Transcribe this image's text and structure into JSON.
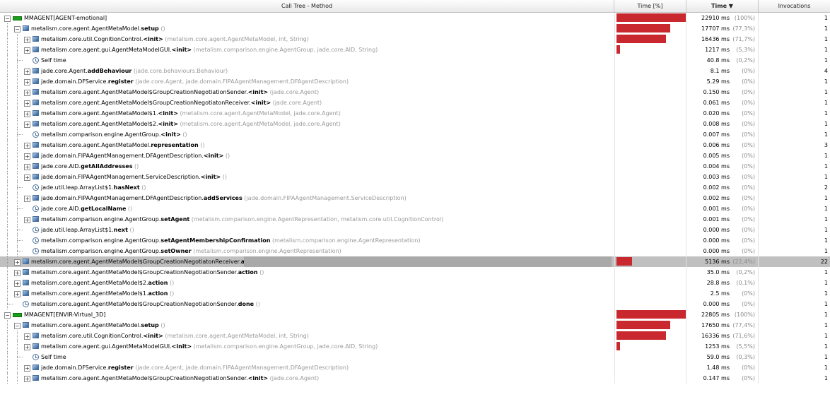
{
  "header": {
    "method": "Call Tree - Method",
    "time_pct": "Time [%]",
    "time": "Time ▼",
    "invocations": "Invocations"
  },
  "rows": [
    {
      "depth": 0,
      "exp": "-",
      "icon": "agent-icon",
      "cls": "",
      "method": "MMAGENT[AGENT-emotional]",
      "sig": "",
      "frac": 1.0,
      "time": "22910 ms",
      "pct": "(100%)",
      "inv": "1"
    },
    {
      "depth": 1,
      "exp": "-",
      "icon": "package-icon",
      "cls": "metalism.core.agent.AgentMetaModel.",
      "method": "setup",
      "sig": " ()",
      "frac": 0.773,
      "time": "17707 ms",
      "pct": "(77,3%)",
      "inv": "1"
    },
    {
      "depth": 2,
      "exp": "+",
      "icon": "package-icon",
      "cls": "metalism.core.util.CognitionControl.",
      "method": "<init>",
      "sig": " (metalism.core.agent.AgentMetaModel, int, String)",
      "frac": 0.717,
      "time": "16436 ms",
      "pct": "(71,7%)",
      "inv": "1"
    },
    {
      "depth": 2,
      "exp": "+",
      "icon": "package-icon",
      "cls": "metalism.core.agent.gui.AgentMetaModelGUI.",
      "method": "<init>",
      "sig": " (metalism.comparison.engine.AgentGroup, jade.core.AID, String)",
      "frac": 0.053,
      "time": "1217 ms",
      "pct": "(5,3%)",
      "inv": "1"
    },
    {
      "depth": 2,
      "exp": "",
      "icon": "clock-icon",
      "cls": "Self time",
      "method": "",
      "sig": "",
      "frac": 0,
      "time": "40.8 ms",
      "pct": "(0,2%)",
      "inv": "1"
    },
    {
      "depth": 2,
      "exp": "+",
      "icon": "package-icon",
      "cls": "jade.core.Agent.",
      "method": "addBehaviour",
      "sig": " (jade.core.behaviours.Behaviour)",
      "frac": 0,
      "time": "8.1 ms",
      "pct": "(0%)",
      "inv": "4"
    },
    {
      "depth": 2,
      "exp": "+",
      "icon": "package-icon",
      "cls": "jade.domain.DFService.",
      "method": "register",
      "sig": " (jade.core.Agent, jade.domain.FIPAAgentManagement.DFAgentDescription)",
      "frac": 0,
      "time": "5.29 ms",
      "pct": "(0%)",
      "inv": "1"
    },
    {
      "depth": 2,
      "exp": "+",
      "icon": "package-icon",
      "cls": "metalism.core.agent.AgentMetaModel$GroupCreationNegotiationSender.",
      "method": "<init>",
      "sig": " (jade.core.Agent)",
      "frac": 0,
      "time": "0.150 ms",
      "pct": "(0%)",
      "inv": "1"
    },
    {
      "depth": 2,
      "exp": "+",
      "icon": "package-icon",
      "cls": "metalism.core.agent.AgentMetaModel$GroupCreationNegotiatonReceiver.",
      "method": "<init>",
      "sig": " (jade.core.Agent)",
      "frac": 0,
      "time": "0.061 ms",
      "pct": "(0%)",
      "inv": "1"
    },
    {
      "depth": 2,
      "exp": "+",
      "icon": "package-icon",
      "cls": "metalism.core.agent.AgentMetaModel$1.",
      "method": "<init>",
      "sig": " (metalism.core.agent.AgentMetaModel, jade.core.Agent)",
      "frac": 0,
      "time": "0.020 ms",
      "pct": "(0%)",
      "inv": "1"
    },
    {
      "depth": 2,
      "exp": "+",
      "icon": "package-icon",
      "cls": "metalism.core.agent.AgentMetaModel$2.",
      "method": "<init>",
      "sig": " (metalism.core.agent.AgentMetaModel, jade.core.Agent)",
      "frac": 0,
      "time": "0.008 ms",
      "pct": "(0%)",
      "inv": "1"
    },
    {
      "depth": 2,
      "exp": "",
      "icon": "clock-icon",
      "cls": "metalism.comparison.engine.AgentGroup.",
      "method": "<init>",
      "sig": " ()",
      "frac": 0,
      "time": "0.007 ms",
      "pct": "(0%)",
      "inv": "1"
    },
    {
      "depth": 2,
      "exp": "+",
      "icon": "package-icon",
      "cls": "metalism.core.agent.AgentMetaModel.",
      "method": "representation",
      "sig": " ()",
      "frac": 0,
      "time": "0.006 ms",
      "pct": "(0%)",
      "inv": "3"
    },
    {
      "depth": 2,
      "exp": "+",
      "icon": "package-icon",
      "cls": "jade.domain.FIPAAgentManagement.DFAgentDescription.",
      "method": "<init>",
      "sig": " ()",
      "frac": 0,
      "time": "0.005 ms",
      "pct": "(0%)",
      "inv": "1"
    },
    {
      "depth": 2,
      "exp": "+",
      "icon": "package-icon",
      "cls": "jade.core.AID.",
      "method": "getAllAddresses",
      "sig": " ()",
      "frac": 0,
      "time": "0.004 ms",
      "pct": "(0%)",
      "inv": "1"
    },
    {
      "depth": 2,
      "exp": "+",
      "icon": "package-icon",
      "cls": "jade.domain.FIPAAgentManagement.ServiceDescription.",
      "method": "<init>",
      "sig": " ()",
      "frac": 0,
      "time": "0.003 ms",
      "pct": "(0%)",
      "inv": "1"
    },
    {
      "depth": 2,
      "exp": "",
      "icon": "clock-icon",
      "cls": "jade.util.leap.ArrayList$1.",
      "method": "hasNext",
      "sig": " ()",
      "frac": 0,
      "time": "0.002 ms",
      "pct": "(0%)",
      "inv": "2"
    },
    {
      "depth": 2,
      "exp": "+",
      "icon": "package-icon",
      "cls": "jade.domain.FIPAAgentManagement.DFAgentDescription.",
      "method": "addServices",
      "sig": " (jade.domain.FIPAAgentManagement.ServiceDescription)",
      "frac": 0,
      "time": "0.002 ms",
      "pct": "(0%)",
      "inv": "1"
    },
    {
      "depth": 2,
      "exp": "",
      "icon": "clock-icon",
      "cls": "jade.core.AID.",
      "method": "getLocalName",
      "sig": " ()",
      "frac": 0,
      "time": "0.001 ms",
      "pct": "(0%)",
      "inv": "1"
    },
    {
      "depth": 2,
      "exp": "+",
      "icon": "package-icon",
      "cls": "metalism.comparison.engine.AgentGroup.",
      "method": "setAgent",
      "sig": " (metalism.comparison.engine.AgentRepresentation, metalism.core.util.CognitionControl)",
      "frac": 0,
      "time": "0.001 ms",
      "pct": "(0%)",
      "inv": "1"
    },
    {
      "depth": 2,
      "exp": "",
      "icon": "clock-icon",
      "cls": "jade.util.leap.ArrayList$1.",
      "method": "next",
      "sig": " ()",
      "frac": 0,
      "time": "0.000 ms",
      "pct": "(0%)",
      "inv": "1"
    },
    {
      "depth": 2,
      "exp": "",
      "icon": "clock-icon",
      "cls": "metalism.comparison.engine.AgentGroup.",
      "method": "setAgentMembershipConfirmation",
      "sig": " (metalism.comparison.engine.AgentRepresentation)",
      "frac": 0,
      "time": "0.000 ms",
      "pct": "(0%)",
      "inv": "1"
    },
    {
      "depth": 2,
      "exp": "",
      "icon": "clock-icon",
      "cls": "metalism.comparison.engine.AgentGroup.",
      "method": "setOwner",
      "sig": " (metalism.comparison.engine.AgentRepresentation)",
      "frac": 0,
      "time": "0.000 ms",
      "pct": "(0%)",
      "inv": "1"
    },
    {
      "depth": 1,
      "exp": "+",
      "icon": "package-icon",
      "cls": "metalism.core.agent.AgentMetaModel$GroupCreationNegotiatonReceiver.",
      "method": "action",
      "sig": " ()",
      "frac": 0.224,
      "time": "5136 ms",
      "pct": "(22,4%)",
      "inv": "22",
      "selected": true
    },
    {
      "depth": 1,
      "exp": "+",
      "icon": "package-icon",
      "cls": "metalism.core.agent.AgentMetaModel$GroupCreationNegotiationSender.",
      "method": "action",
      "sig": " ()",
      "frac": 0,
      "time": "35.0 ms",
      "pct": "(0,2%)",
      "inv": "1"
    },
    {
      "depth": 1,
      "exp": "+",
      "icon": "package-icon",
      "cls": "metalism.core.agent.AgentMetaModel$2.",
      "method": "action",
      "sig": " ()",
      "frac": 0,
      "time": "28.8 ms",
      "pct": "(0,1%)",
      "inv": "1"
    },
    {
      "depth": 1,
      "exp": "+",
      "icon": "package-icon",
      "cls": "metalism.core.agent.AgentMetaModel$1.",
      "method": "action",
      "sig": " ()",
      "frac": 0,
      "time": "2.5 ms",
      "pct": "(0%)",
      "inv": "1"
    },
    {
      "depth": 1,
      "exp": "",
      "icon": "clock-icon",
      "cls": "metalism.core.agent.AgentMetaModel$GroupCreationNegotiationSender.",
      "method": "done",
      "sig": " ()",
      "frac": 0,
      "time": "0.000 ms",
      "pct": "(0%)",
      "inv": "1"
    },
    {
      "depth": 0,
      "exp": "-",
      "icon": "agent-icon",
      "cls": "",
      "method": "MMAGENT[ENVIR-Virtual_3D]",
      "sig": "",
      "frac": 1.0,
      "time": "22805 ms",
      "pct": "(100%)",
      "inv": "1"
    },
    {
      "depth": 1,
      "exp": "-",
      "icon": "package-icon",
      "cls": "metalism.core.agent.AgentMetaModel.",
      "method": "setup",
      "sig": " ()",
      "frac": 0.774,
      "time": "17650 ms",
      "pct": "(77,4%)",
      "inv": "1"
    },
    {
      "depth": 2,
      "exp": "+",
      "icon": "package-icon",
      "cls": "metalism.core.util.CognitionControl.",
      "method": "<init>",
      "sig": " (metalism.core.agent.AgentMetaModel, int, String)",
      "frac": 0.716,
      "time": "16336 ms",
      "pct": "(71,6%)",
      "inv": "1"
    },
    {
      "depth": 2,
      "exp": "+",
      "icon": "package-icon",
      "cls": "metalism.core.agent.gui.AgentMetaModelGUI.",
      "method": "<init>",
      "sig": " (metalism.comparison.engine.AgentGroup, jade.core.AID, String)",
      "frac": 0.055,
      "time": "1253 ms",
      "pct": "(5,5%)",
      "inv": "1"
    },
    {
      "depth": 2,
      "exp": "",
      "icon": "clock-icon",
      "cls": "Self time",
      "method": "",
      "sig": "",
      "frac": 0,
      "time": "59.0 ms",
      "pct": "(0,3%)",
      "inv": "1"
    },
    {
      "depth": 2,
      "exp": "+",
      "icon": "package-icon",
      "cls": "jade.domain.DFService.",
      "method": "register",
      "sig": " (jade.core.Agent, jade.domain.FIPAAgentManagement.DFAgentDescription)",
      "frac": 0,
      "time": "1.48 ms",
      "pct": "(0%)",
      "inv": "1"
    },
    {
      "depth": 2,
      "exp": "+",
      "icon": "package-icon",
      "cls": "metalism.core.agent.AgentMetaModel$GroupCreationNegotiationSender.",
      "method": "<init>",
      "sig": " (jade.core.Agent)",
      "frac": 0,
      "time": "0.147 ms",
      "pct": "(0%)",
      "inv": "1"
    }
  ],
  "colors": {
    "bar": "#c8282e",
    "selected_row": "#c0c0c0"
  }
}
